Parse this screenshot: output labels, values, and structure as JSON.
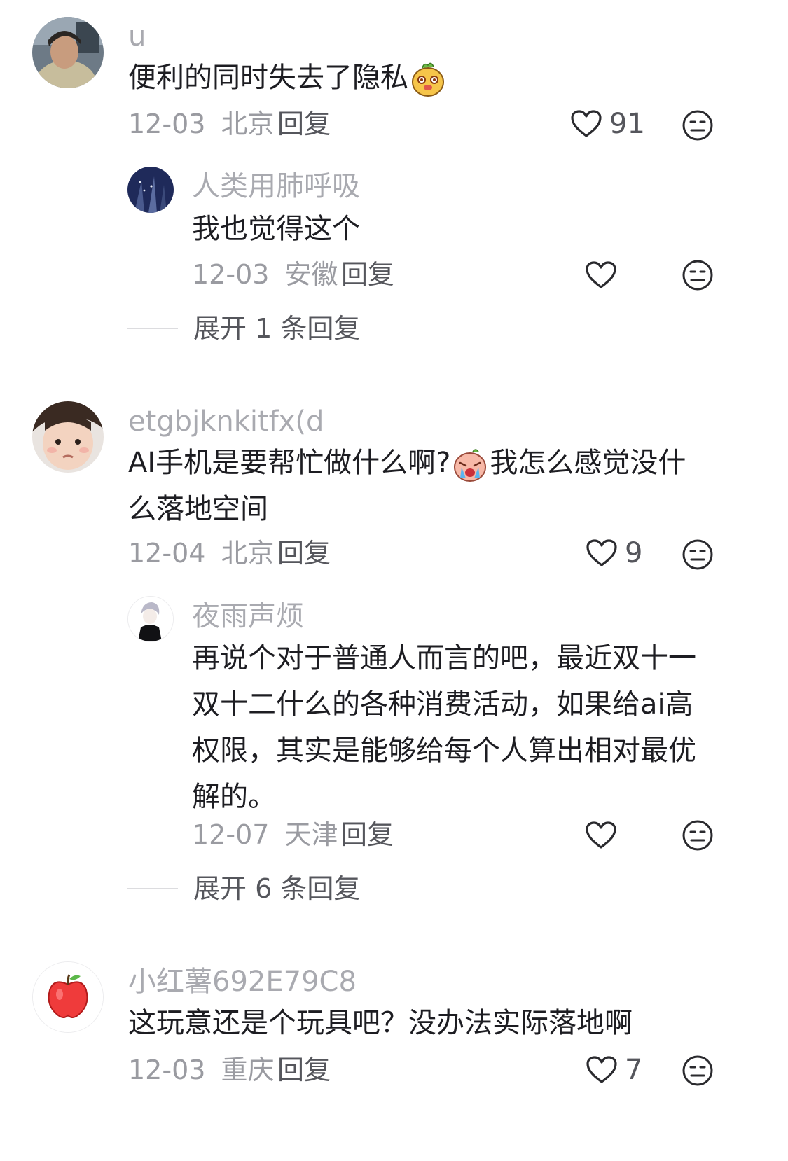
{
  "comments": [
    {
      "user": "u",
      "text": "便利的同时失去了隐私",
      "emoji": "dog-face-emoji",
      "date": "12-03",
      "location": "北京",
      "reply_label": "回复",
      "likes": "91",
      "replies": [
        {
          "user": "人类用肺呼吸",
          "text": "我也觉得这个",
          "date": "12-03",
          "location": "安徽",
          "reply_label": "回复"
        }
      ],
      "expand_label": "展开 1 条回复"
    },
    {
      "user": "etgbjknkitfx(d",
      "text_line1_a": "AI手机是要帮忙做什么啊?",
      "emoji": "crying-face-emoji",
      "text_line1_b": "我怎么感觉没什",
      "text_line2": "么落地空间",
      "date": "12-04",
      "location": "北京",
      "reply_label": "回复",
      "likes": "9",
      "replies": [
        {
          "user": "夜雨声烦",
          "lines": [
            "再说个对于普通人而言的吧，最近双十一",
            "双十二什么的各种消费活动，如果给ai高",
            "权限，其实是能够给每个人算出相对最优",
            "解的。"
          ],
          "date": "12-07",
          "location": "天津",
          "reply_label": "回复"
        }
      ],
      "expand_label": "展开 6 条回复"
    },
    {
      "user": "小红薯692E79C8",
      "text": "这玩意还是个玩具吧？没办法实际落地啊",
      "date": "12-03",
      "location": "重庆",
      "reply_label": "回复",
      "likes": "7"
    }
  ],
  "icons": {
    "like": "heart-outline-icon",
    "dislike": "meh-face-icon"
  },
  "colors": {
    "username": "#a9aab0",
    "text": "#1d1d22",
    "meta": "#9a9ba1",
    "action": "#55565c"
  }
}
